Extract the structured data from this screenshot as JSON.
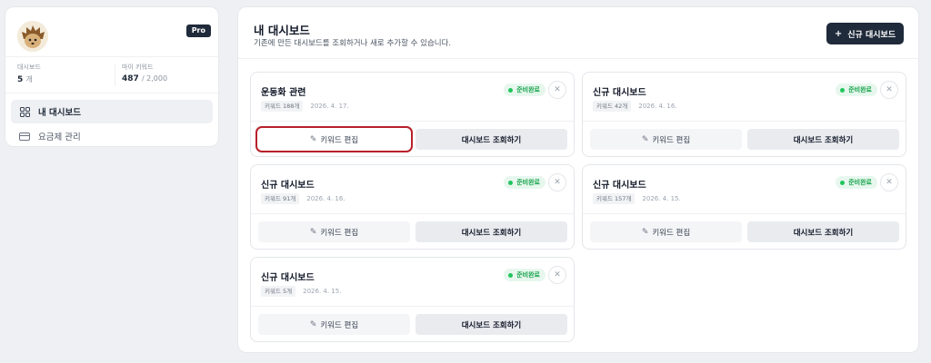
{
  "sidebar": {
    "pro_badge": "Pro",
    "stats": [
      {
        "label": "대시보드",
        "value": "5",
        "unit": "개"
      },
      {
        "label": "마이 키워드",
        "value": "487",
        "unit": "/ 2,000"
      }
    ],
    "menu": [
      {
        "label": "내 대시보드",
        "icon": "dashboard-grid-icon",
        "active": true
      },
      {
        "label": "요금제 관리",
        "icon": "credit-card-icon",
        "active": false
      }
    ]
  },
  "main": {
    "title": "내 대시보드",
    "subtitle": "기존에 만든 대시보드를 조회하거나 새로 추가할 수 있습니다.",
    "new_button": "신규 대시보드",
    "new_button_icon": "plus-icon",
    "cards": [
      {
        "title": "운동화 관련",
        "keywords": "키워드 188개",
        "date": "2026. 4. 17.",
        "status": "준비완료",
        "edit_label": "키워드 편집",
        "view_label": "대시보드 조회하기"
      },
      {
        "title": "신규 대시보드",
        "keywords": "키워드 42개",
        "date": "2026. 4. 16.",
        "status": "준비완료",
        "edit_label": "키워드 편집",
        "view_label": "대시보드 조회하기"
      },
      {
        "title": "신규 대시보드",
        "keywords": "키워드 91개",
        "date": "2026. 4. 16.",
        "status": "준비완료",
        "edit_label": "키워드 편집",
        "view_label": "대시보드 조회하기"
      },
      {
        "title": "신규 대시보드",
        "keywords": "키워드 157개",
        "date": "2026. 4. 15.",
        "status": "준비완료",
        "edit_label": "키워드 편집",
        "view_label": "대시보드 조회하기"
      },
      {
        "title": "신규 대시보드",
        "keywords": "키워드 5개",
        "date": "2026. 4. 15.",
        "status": "준비완료",
        "edit_label": "키워드 편집",
        "view_label": "대시보드 조회하기"
      }
    ]
  },
  "colors": {
    "primary": "#1f2a3a",
    "status_green": "#16a34a",
    "highlight": "#b8202b"
  }
}
